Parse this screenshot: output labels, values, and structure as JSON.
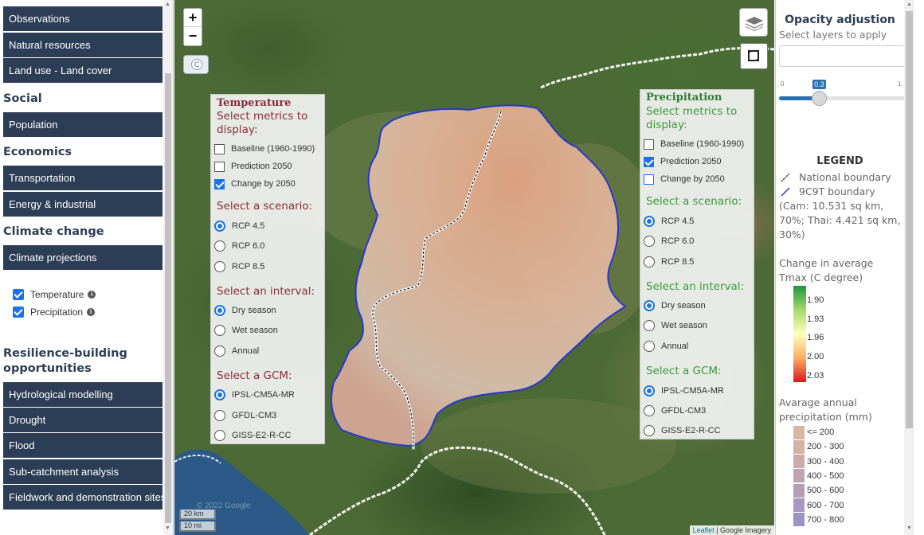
{
  "sidebar": {
    "items_top": [
      "Observations",
      "Natural resources",
      "Land use - Land cover"
    ],
    "heading_social": "Social",
    "item_population": "Population",
    "heading_economics": "Economics",
    "items_economics": [
      "Transportation",
      "Energy & industrial"
    ],
    "heading_climate": "Climate change",
    "item_climate": "Climate projections",
    "checks": [
      "Temperature",
      "Precipitation"
    ],
    "heading_resilience": "Resilience-building opportunities",
    "items_resilience": [
      "Hydrological modelling",
      "Drought",
      "Flood",
      "Sub-catchment analysis",
      "Fieldwork and demonstration sites"
    ]
  },
  "map": {
    "zoom_in": "+",
    "zoom_out": "−",
    "c_button": "C",
    "scale_km": "20 km",
    "scale_mi": "10 mi",
    "attribution_leaflet": "Leaflet",
    "attribution_sep": " | ",
    "attribution_imagery": "Google Imagery",
    "watermark": "© 2022 Google"
  },
  "temperature_panel": {
    "title": "Temperature",
    "metrics_prompt": "Select metrics to display:",
    "metrics": [
      "Baseline (1960-1990)",
      "Prediction 2050",
      "Change by 2050"
    ],
    "scenario_prompt": "Select a scenario:",
    "scenarios": [
      "RCP 4.5",
      "RCP 6.0",
      "RCP 8.5"
    ],
    "interval_prompt": "Select an interval:",
    "intervals": [
      "Dry season",
      "Wet season",
      "Annual"
    ],
    "gcm_prompt": "Select a GCM:",
    "gcms": [
      "IPSL-CM5A-MR",
      "GFDL-CM3",
      "GISS-E2-R-CC"
    ],
    "color": "#8b2d3c"
  },
  "precipitation_panel": {
    "title": "Precipitation",
    "metrics_prompt": "Select metrics to display:",
    "metrics": [
      "Baseline (1960-1990)",
      "Prediction 2050",
      "Change by 2050"
    ],
    "scenario_prompt": "Select a scenario:",
    "scenarios": [
      "RCP 4.5",
      "RCP 6.0",
      "RCP 8.5"
    ],
    "interval_prompt": "Select an interval:",
    "intervals": [
      "Dry season",
      "Wet season",
      "Annual"
    ],
    "gcm_prompt": "Select a GCM:",
    "gcms": [
      "IPSL-CM5A-MR",
      "GFDL-CM3",
      "GISS-E2-R-CC"
    ],
    "color": "#3a9a3a"
  },
  "opacity": {
    "title": "Opacity adjustion",
    "subtitle": "Select layers to apply",
    "min": "0",
    "max": "1",
    "value": "0.3"
  },
  "legend": {
    "title": "LEGEND",
    "national_boundary": "National boundary",
    "basin_boundary": "9C9T boundary",
    "basin_note": "(Cam: 10.531 sq km, 70%; Thai: 4.421 sq km, 30%)",
    "tmax_title": "Change in average Tmax (C degree)",
    "tmax_values": [
      "1.90",
      "1.93",
      "1.96",
      "2.00",
      "2.03"
    ],
    "precip_title": "Avarage annual precipitation (mm)",
    "precip_classes": [
      "<= 200",
      "200 - 300",
      "300 - 400",
      "400 - 500",
      "500 - 600",
      "600 - 700",
      "700 - 800"
    ],
    "precip_colors": [
      "#d8b8a2",
      "#d3b3a3",
      "#cbacaa",
      "#c1a4b0",
      "#b69db8",
      "#a897c0",
      "#9c92c6"
    ]
  },
  "colors": {
    "sidebar_button": "#2c3e55",
    "accent_blue": "#1a73e8",
    "basin_outline": "#2233dd"
  }
}
